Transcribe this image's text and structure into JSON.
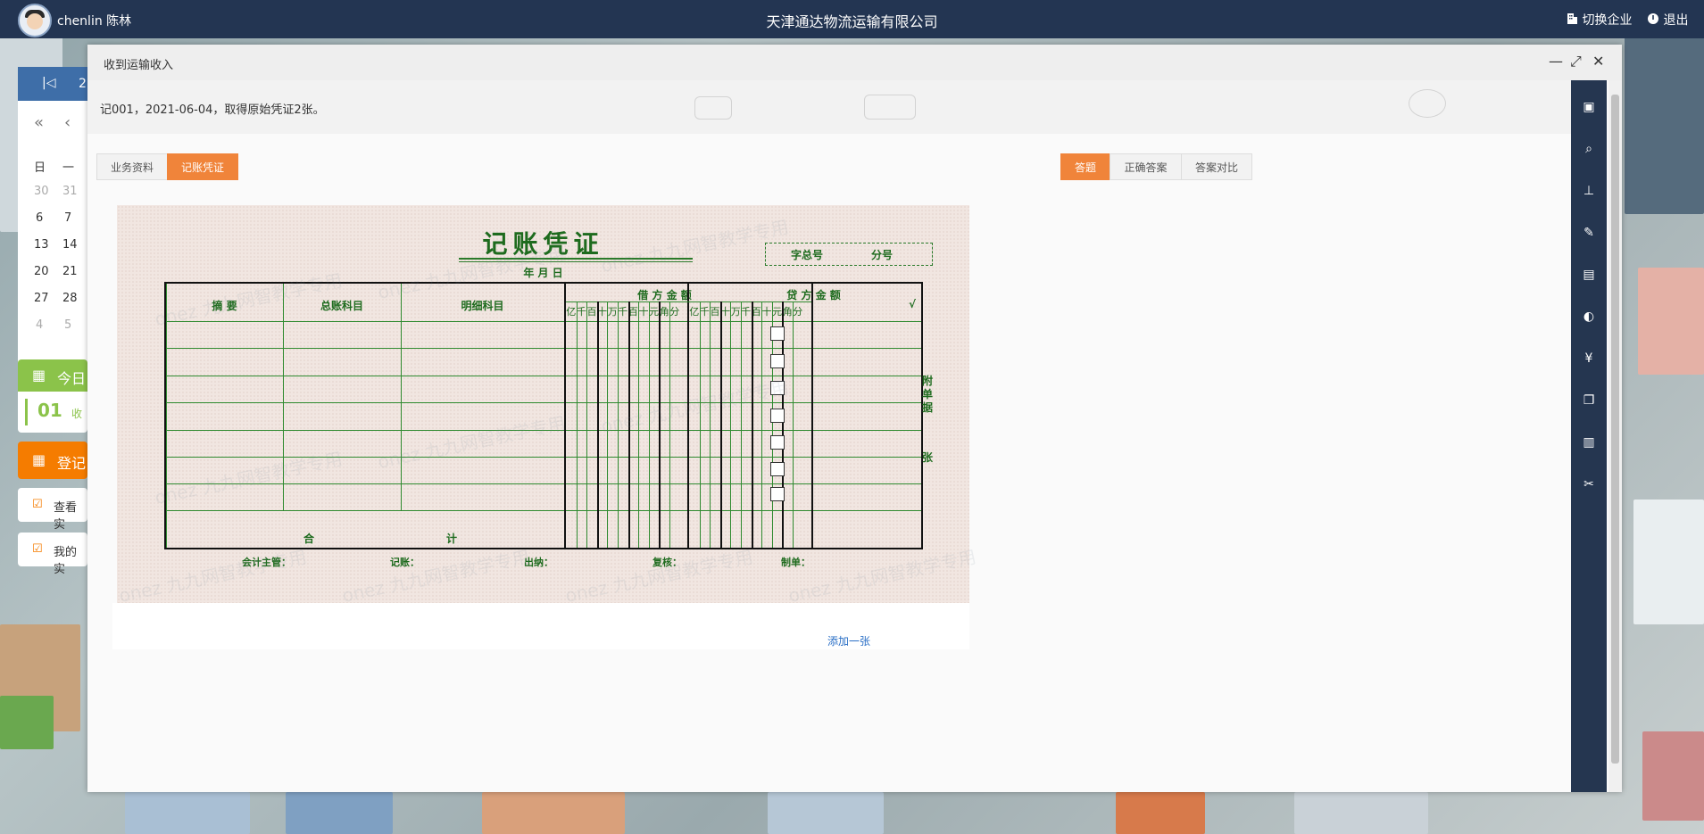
{
  "topbar": {
    "username": "chenlin 陈林",
    "company": "天津通达物流运输有限公司",
    "switch_label": "切换企业",
    "logout_label": "退出"
  },
  "left_panel": {
    "weekday_sun": "日",
    "weekday_mon": "一",
    "cal_rows": [
      [
        "30",
        "31"
      ],
      [
        "6",
        "7"
      ],
      [
        "13",
        "14"
      ],
      [
        "20",
        "21"
      ],
      [
        "27",
        "28"
      ],
      [
        "4",
        "5"
      ]
    ],
    "today_label": "今日",
    "today_num": "01",
    "today_item": "收",
    "register_label": "登记",
    "view_label": "查看实",
    "mine_label": "我的实",
    "year_partial": "2"
  },
  "modal": {
    "title": "收到运输收入",
    "info": "记001，2021-06-04，取得原始凭证2张。",
    "tabs_left": [
      "业务资料",
      "记账凭证"
    ],
    "tabs_right": [
      "答题",
      "正确答案",
      "答案对比"
    ],
    "add_one": "添加一张"
  },
  "voucher": {
    "title": "记账凭证",
    "date_label": "年 月 日",
    "zi_label": "字总号",
    "fen_label": "分号",
    "col_summary": "摘 要",
    "col_ledger": "总账科目",
    "col_detail": "明细科目",
    "col_debit": "借 方 金 额",
    "col_credit": "贷 方 金 额",
    "col_check": "√",
    "digits": [
      "亿",
      "千",
      "百",
      "十",
      "万",
      "千",
      "百",
      "十",
      "元",
      "角",
      "分"
    ],
    "total_label_1": "合",
    "total_label_2": "计",
    "attach_label": "附单据",
    "zhang_label": "张",
    "footer": [
      "会计主管：",
      "记账：",
      "出纳：",
      "复核：",
      "制单："
    ],
    "watermark": "onez 九九网智教学专用"
  },
  "toolbar_icons": [
    "save-icon",
    "search-icon",
    "stamp-icon",
    "pen-icon",
    "edit-doc-icon",
    "toggle-icon",
    "yuan-icon",
    "copy-icon",
    "building-icon",
    "tools-icon"
  ]
}
